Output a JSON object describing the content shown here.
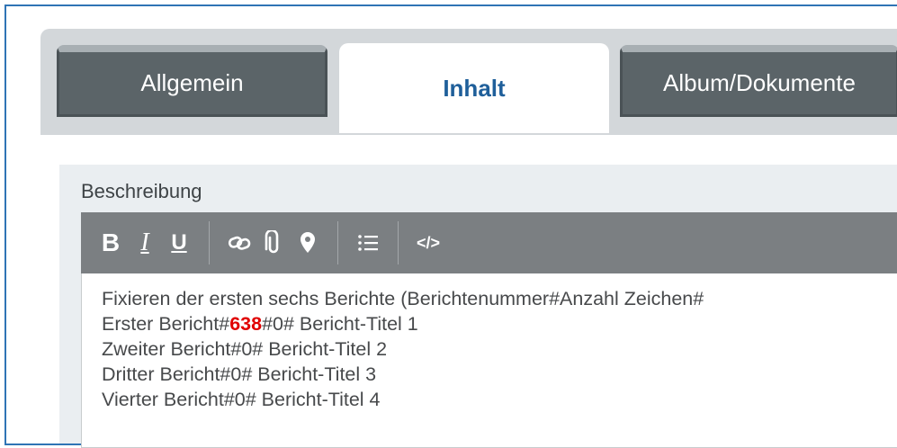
{
  "tabs": [
    {
      "label": "Allgemein"
    },
    {
      "label": "Inhalt"
    },
    {
      "label": "Album/Dokumente"
    }
  ],
  "field": {
    "label": "Beschreibung"
  },
  "toolbar": {
    "icons": [
      "bold-icon",
      "italic-icon",
      "underline-icon",
      "link-icon",
      "attachment-icon",
      "location-pin-icon",
      "bullet-list-icon",
      "code-view-icon"
    ],
    "bold": "B",
    "italic": "I",
    "underline": "U",
    "code": "</>"
  },
  "content": {
    "line1": "Fixieren der ersten sechs Berichte (Berichtenummer#Anzahl Zeichen#",
    "line2_prefix": "Erster Bericht#",
    "line2_highlight": "638",
    "line2_suffix": "#0# Bericht-Titel 1",
    "line3": "Zweiter Bericht#0# Bericht-Titel 2",
    "line4": "Dritter Bericht#0# Bericht-Titel 3",
    "line5": "Vierter Bericht#0# Bericht-Titel 4"
  },
  "colors": {
    "frame_border": "#2f74b5",
    "tab_inactive": "#5b6468",
    "tab_active_text": "#1f5f9a",
    "toolbar": "#7b7f82",
    "highlight": "#e00000"
  }
}
